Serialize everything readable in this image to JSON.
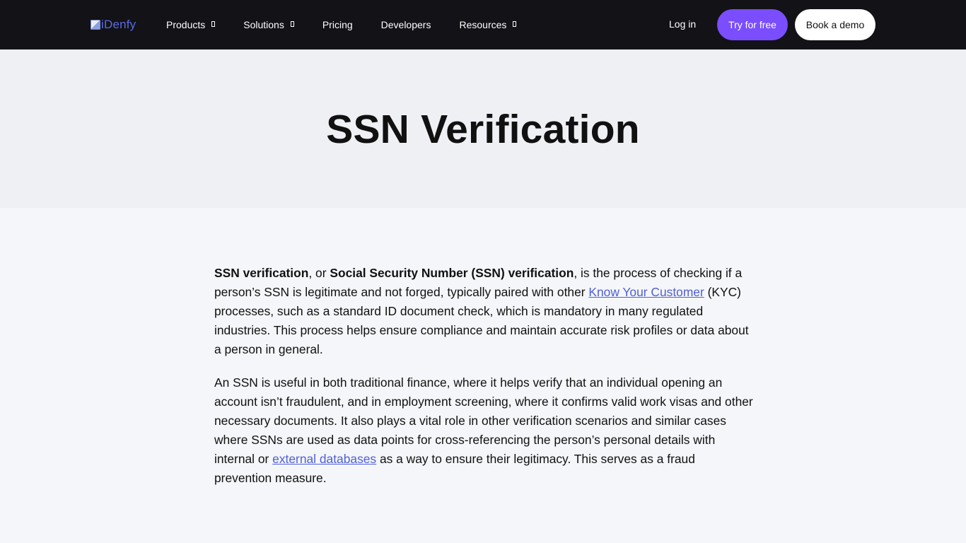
{
  "header": {
    "logo_alt": "iDenfy",
    "nav": [
      {
        "label": "Products",
        "caret": true
      },
      {
        "label": "Solutions",
        "caret": true
      },
      {
        "label": "Pricing",
        "caret": false
      },
      {
        "label": "Developers",
        "caret": false
      },
      {
        "label": "Resources",
        "caret": true
      }
    ],
    "login": "Log in",
    "try_free": "Try for free",
    "book_demo": "Book a demo",
    "colors": {
      "bar": "#121217",
      "accent": "#7a4dff"
    }
  },
  "hero": {
    "title": "SSN Verification"
  },
  "article": {
    "p1": {
      "b1": "SSN verification",
      "t1": ", or ",
      "b2": "Social Security Number (SSN) verification",
      "t2": ", is the process of checking if a person’s SSN is legitimate and not forged, typically paired with other ",
      "link": "Know Your Customer",
      "t3": " (KYC) processes, such as a standard ID document check, which is mandatory in many regulated industries. This process helps ensure compliance and maintain accurate risk profiles or data about a person in general."
    },
    "p2": {
      "t1": "An SSN is useful in both traditional finance, where it helps verify that an individual opening an account isn’t fraudulent, and in employment screening, where it confirms valid work visas and other necessary documents. It also plays a vital role in other verification scenarios and similar cases where SSNs are used as data points for cross-referencing the person’s personal details with internal or ",
      "link": "external databases",
      "t2": " as a way to ensure their legitimacy. This serves as a fraud prevention measure."
    },
    "link_color": "#4f5fd6"
  }
}
